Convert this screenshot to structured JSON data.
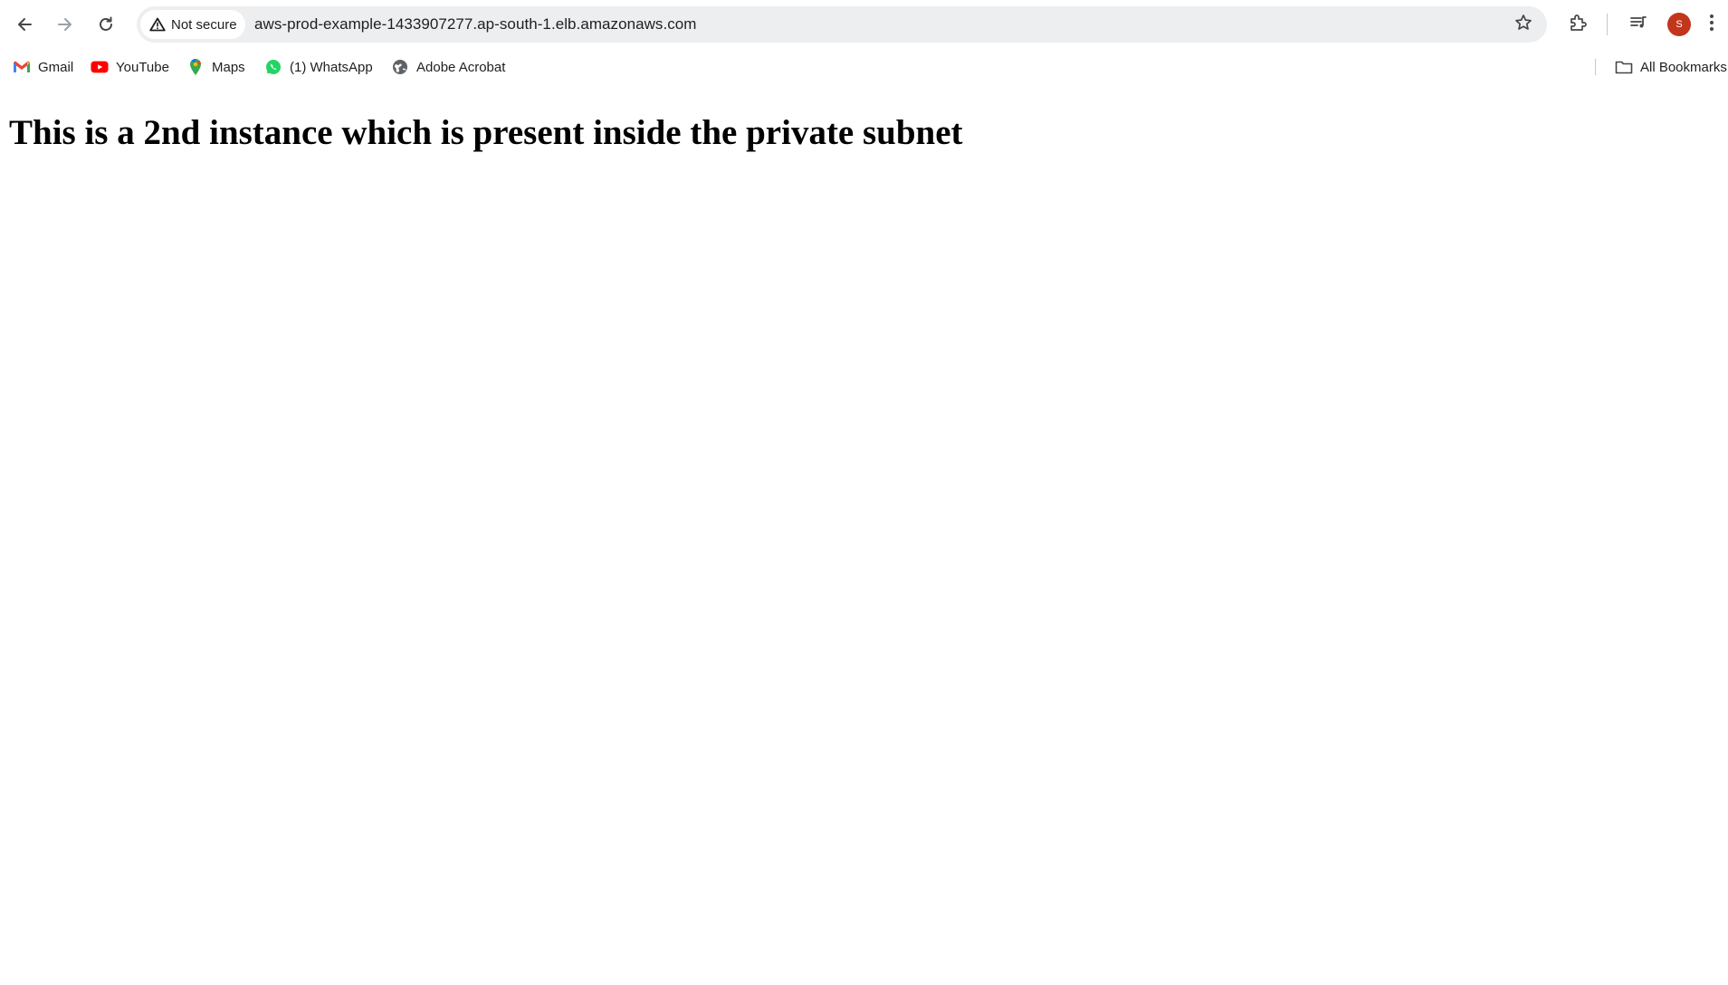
{
  "browser": {
    "security_label": "Not secure",
    "url": "aws-prod-example-1433907277.ap-south-1.elb.amazonaws.com",
    "avatar_letter": "S",
    "avatar_color": "#c2361c"
  },
  "bookmarks": {
    "items": [
      {
        "label": "Gmail",
        "icon": "gmail-icon"
      },
      {
        "label": "YouTube",
        "icon": "youtube-icon"
      },
      {
        "label": "Maps",
        "icon": "maps-icon"
      },
      {
        "label": "(1) WhatsApp",
        "icon": "whatsapp-icon"
      },
      {
        "label": "Adobe Acrobat",
        "icon": "globe-icon"
      }
    ],
    "all_bookmarks_label": "All Bookmarks"
  },
  "page": {
    "heading": "This is a 2nd instance which is present inside the private subnet"
  }
}
